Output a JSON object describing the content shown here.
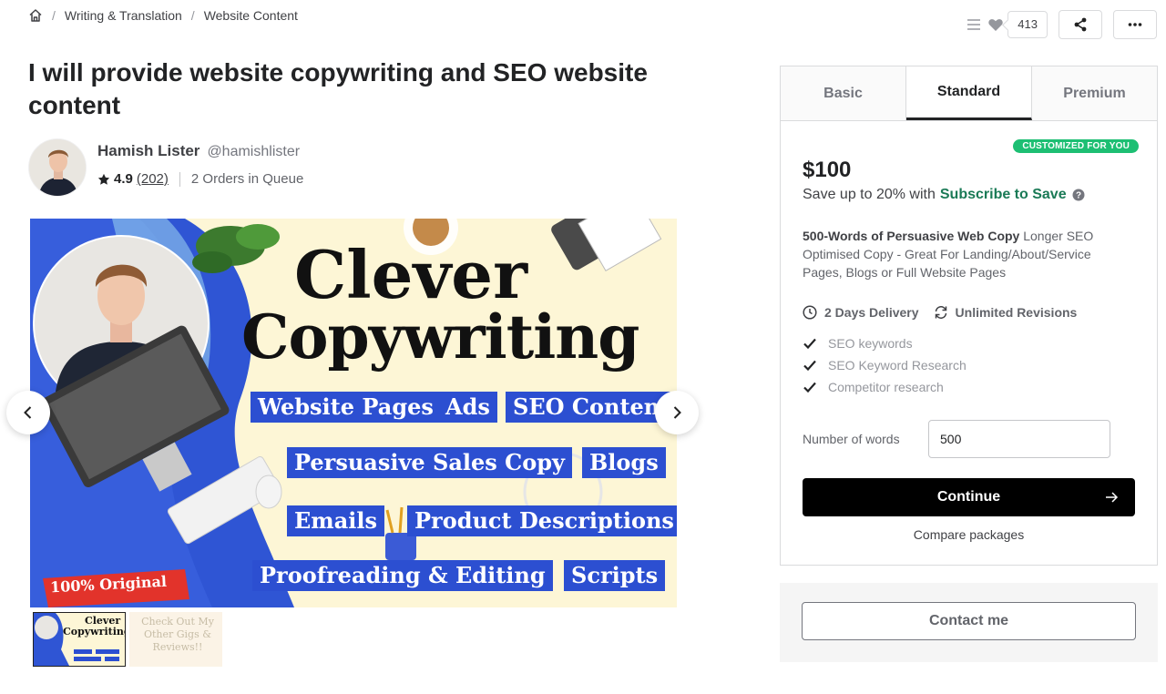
{
  "breadcrumb": {
    "home_icon": "home-icon",
    "items": [
      "Writing & Translation",
      "Website Content"
    ]
  },
  "actions": {
    "save_count": "413",
    "icons": [
      "collections-icon",
      "heart-icon",
      "share-icon",
      "more-icon"
    ]
  },
  "gig": {
    "title": "I will provide website copywriting and SEO website content"
  },
  "seller": {
    "name": "Hamish Lister",
    "handle": "@hamishlister",
    "rating": "4.9",
    "rating_count": "(202)",
    "queue": "2 Orders in Queue"
  },
  "gallery": {
    "headline_1": "Clever",
    "headline_2": "Copywriting",
    "tags": [
      "Website Pages",
      "Ads",
      "SEO Content",
      "Persuasive Sales Copy",
      "Blogs",
      "Emails",
      "Product Descriptions",
      "Proofreading & Editing",
      "Scripts"
    ],
    "ribbon": "100% Original",
    "thumb_2_text": "Check Out My Other Gigs & Reviews!!"
  },
  "package": {
    "tabs": [
      "Basic",
      "Standard",
      "Premium"
    ],
    "active_tab": "Standard",
    "badge": "CUSTOMIZED FOR YOU",
    "price": "$100",
    "save_prefix": "Save up to 20% with",
    "subscribe_label": "Subscribe to Save",
    "desc_title": "500-Words of Persuasive Web Copy",
    "desc_body": "Longer SEO Optimised Copy - Great For Landing/About/Service Pages, Blogs or Full Website Pages",
    "delivery": "2 Days Delivery",
    "revisions": "Unlimited Revisions",
    "features": [
      "SEO keywords",
      "SEO Keyword Research",
      "Competitor research"
    ],
    "words_label": "Number of words",
    "words_value": "500",
    "continue_label": "Continue",
    "compare_label": "Compare packages"
  },
  "contact": {
    "label": "Contact me"
  },
  "colors": {
    "accent_green": "#1dbf73",
    "subscribe_green": "#1a7a56",
    "tag_blue": "#2c4fd1"
  }
}
